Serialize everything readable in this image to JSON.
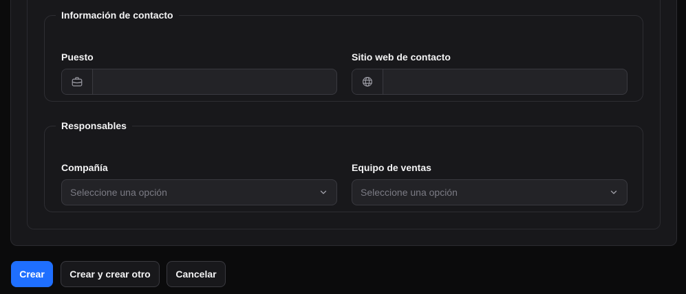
{
  "contact_section": {
    "title": "Información de contacto",
    "position_field": {
      "label": "Puesto",
      "value": "",
      "icon": "briefcase-icon"
    },
    "website_field": {
      "label": "Sitio web de contacto",
      "value": "",
      "icon": "globe-icon"
    }
  },
  "responsible_section": {
    "title": "Responsables",
    "company_field": {
      "label": "Compañía",
      "placeholder": "Seleccione una opción"
    },
    "sales_team_field": {
      "label": "Equipo de ventas",
      "placeholder": "Seleccione una opción"
    }
  },
  "actions": {
    "create_label": "Crear",
    "create_another_label": "Crear y crear otro",
    "cancel_label": "Cancelar"
  },
  "colors": {
    "primary": "#1f6fff",
    "background": "#0b0b0c",
    "card": "#18181b",
    "border": "#2e2e33"
  }
}
